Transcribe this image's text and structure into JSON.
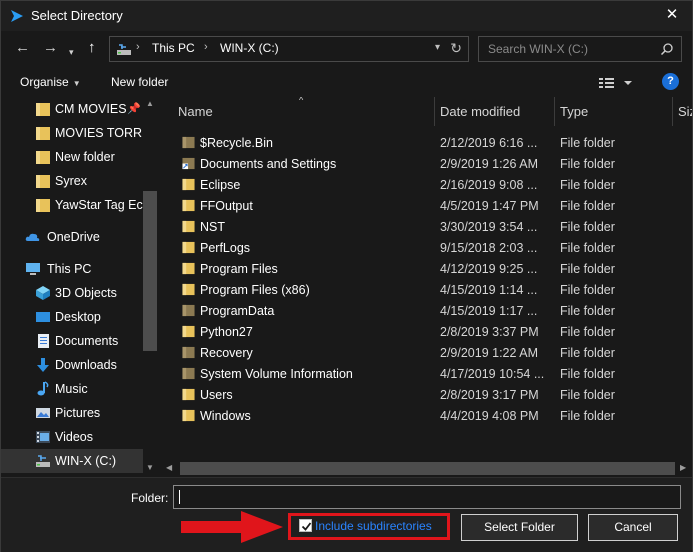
{
  "window": {
    "title": "Select Directory"
  },
  "nav": {
    "breadcrumbs": [
      "This PC",
      "WIN-X (C:)"
    ],
    "search_placeholder": "Search WIN-X (C:)"
  },
  "toolbar": {
    "organise_label": "Organise",
    "new_folder_label": "New folder",
    "help_label": "?"
  },
  "sidebar": {
    "items": [
      {
        "label": "CM MOVIES",
        "icon": "folder-icon",
        "pinned": true
      },
      {
        "label": "MOVIES TORRE",
        "icon": "folder-icon"
      },
      {
        "label": "New folder",
        "icon": "folder-icon"
      },
      {
        "label": "Syrex",
        "icon": "folder-icon"
      },
      {
        "label": "YawStar Tag Ec",
        "icon": "folder-icon"
      },
      {
        "label": "OneDrive",
        "icon": "cloud-icon"
      },
      {
        "label": "This PC",
        "icon": "computer-icon"
      },
      {
        "label": "3D Objects",
        "icon": "cube-icon"
      },
      {
        "label": "Desktop",
        "icon": "desktop-icon"
      },
      {
        "label": "Documents",
        "icon": "documents-icon"
      },
      {
        "label": "Downloads",
        "icon": "download-icon"
      },
      {
        "label": "Music",
        "icon": "music-icon"
      },
      {
        "label": "Pictures",
        "icon": "pictures-icon"
      },
      {
        "label": "Videos",
        "icon": "videos-icon"
      },
      {
        "label": "WIN-X (C:)",
        "icon": "drive-icon",
        "selected": true
      }
    ]
  },
  "columns": [
    "Name",
    "Date modified",
    "Type",
    "Siz"
  ],
  "files": [
    {
      "name": "$Recycle.Bin",
      "date": "2/12/2019 6:16 ...",
      "type": "File folder",
      "icon": "folder-gray"
    },
    {
      "name": "Documents and Settings",
      "date": "2/9/2019 1:26 AM",
      "type": "File folder",
      "icon": "folder-shortcut"
    },
    {
      "name": "Eclipse",
      "date": "2/16/2019 9:08 ...",
      "type": "File folder",
      "icon": "folder"
    },
    {
      "name": "FFOutput",
      "date": "4/5/2019 1:47 PM",
      "type": "File folder",
      "icon": "folder"
    },
    {
      "name": "NST",
      "date": "3/30/2019 3:54 ...",
      "type": "File folder",
      "icon": "folder"
    },
    {
      "name": "PerfLogs",
      "date": "9/15/2018 2:03 ...",
      "type": "File folder",
      "icon": "folder"
    },
    {
      "name": "Program Files",
      "date": "4/12/2019 9:25 ...",
      "type": "File folder",
      "icon": "folder"
    },
    {
      "name": "Program Files (x86)",
      "date": "4/15/2019 1:14 ...",
      "type": "File folder",
      "icon": "folder"
    },
    {
      "name": "ProgramData",
      "date": "4/15/2019 1:17 ...",
      "type": "File folder",
      "icon": "folder-gray"
    },
    {
      "name": "Python27",
      "date": "2/8/2019 3:37 PM",
      "type": "File folder",
      "icon": "folder"
    },
    {
      "name": "Recovery",
      "date": "2/9/2019 1:22 AM",
      "type": "File folder",
      "icon": "folder-gray"
    },
    {
      "name": "System Volume Information",
      "date": "4/17/2019 10:54 ...",
      "type": "File folder",
      "icon": "folder-gray"
    },
    {
      "name": "Users",
      "date": "2/8/2019 3:17 PM",
      "type": "File folder",
      "icon": "folder"
    },
    {
      "name": "Windows",
      "date": "4/4/2019 4:08 PM",
      "type": "File folder",
      "icon": "folder"
    }
  ],
  "footer": {
    "folder_label": "Folder:",
    "folder_value": "",
    "include_subdirectories_label": "Include subdirectories",
    "include_subdirectories_checked": true,
    "select_button": "Select Folder",
    "cancel_button": "Cancel"
  },
  "colors": {
    "folder": "#e8c25a",
    "folder_gray": "#8c7a52",
    "accent_blue": "#2a84ff",
    "annotation_red": "#e0151b"
  }
}
